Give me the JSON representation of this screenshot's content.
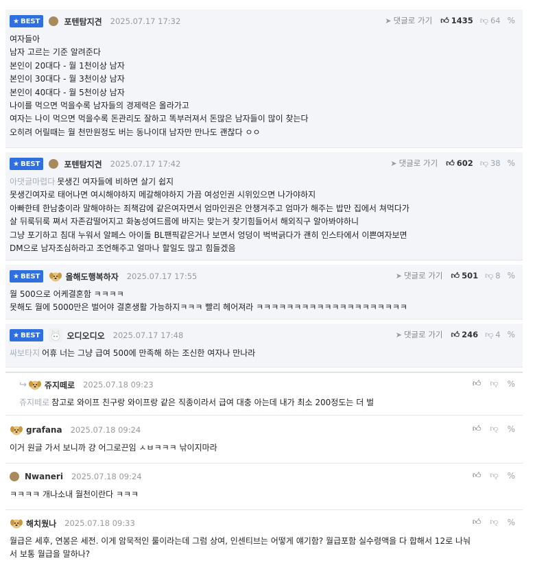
{
  "labels": {
    "best": "BEST",
    "goto": "댓글로 가기"
  },
  "comments": [
    {
      "author": "포텐탐지견",
      "date": "2025.07.17 17:32",
      "likes": "1435",
      "dislikes": "64",
      "lines": [
        "여자들아",
        "남자 고르는 기준 알려준다",
        "본인이 20대다 - 월 1천이상 남자",
        "본인이 30대다 - 월 3천이상 남자",
        "본인이 40대다 - 월 5천이상 남자",
        "나이를 먹으면 먹을수록 남자들의 경제력은 올라가고",
        "여자는 나이 먹으면 먹을수록 돈관리도 잘하고 똑부러져서 돈많은 남자들이 많이 찾는다",
        "오히려 어릴때는 월 천만원정도 버는 동나이대 남자만 만나도 괜찮다 ㅇㅇ"
      ]
    },
    {
      "author": "포텐탐지견",
      "date": "2025.07.17 17:42",
      "likes": "602",
      "dislikes": "38",
      "mention": "아댓글마렵다",
      "lines": [
        "못생긴 여자들에 비하면 살기 쉽지",
        "못생긴여자로 태어나면 여시해야하지 메갈해야하지 가끔 여성인권 시위있으면 나가야하지",
        "아빠한테 한남충이라 말해야하는 죄책감에 같은여자면서 엄마인권은 안챙겨주고 엄마가 해주는 밥만 집에서 쳐먹다가",
        "살 뒤룩뒤룩 쪄서 자존감떨어지고 화농성여드름에 바지는 맞는거 찾기힘들어서 해외직구 알아봐야하니",
        "그냥 포기하고 침대 누워서 알페스 아이돌 BL팬픽같은거나 보면서 엉덩이 벅벅긁다가 괜히 인스타에서 이쁜여자보면",
        "DM으로 남자조심하라고 조언해주고 얼마나 할일도 많고 힘들겠음"
      ]
    },
    {
      "author": "올해도행복하자",
      "date": "2025.07.17 17:55",
      "likes": "501",
      "dislikes": "8",
      "lines": [
        "월 500으로 어케결혼함 ㅋㅋㅋㅋ",
        "못해도 월에 5000만은 벌어야 결혼생활 가능하지ㅋㅋㅋ 빨리 헤어져라 ㅋㅋㅋㅋㅋㅋㅋㅋㅋㅋㅋㅋㅋㅋㅋㅋㅋㅋㅋㅋ"
      ]
    },
    {
      "author": "오디오디오",
      "date": "2025.07.17 17:48",
      "likes": "246",
      "dislikes": "4",
      "mention": "싸보타지",
      "lines": [
        "어휴 너는 그냥 급여 500에 만족해 하는 조신한 여자나 만나라"
      ]
    },
    {
      "author": "쥬지떼로",
      "date": "2025.07.18 09:23",
      "mention": "쥬지떼로",
      "lines": [
        "참고로 와이프 친구랑 와이프랑 같은 직종이라서 급여 대충 아는데 내가 최소 200정도는 더 벌"
      ]
    },
    {
      "author": "grafana",
      "date": "2025.07.18 09:24",
      "lines": [
        "이거 원글 가서 보니까 걍 어그로끈임 ㅅㅂㅋㅋㅋ 낚이지마라"
      ]
    },
    {
      "author": "Nwaneri",
      "date": "2025.07.18 09:24",
      "lines": [
        "ㅋㅋㅋㅋ 개나소내 월천이란다 ㅋㅋㅋ"
      ]
    },
    {
      "author": "해치웠나",
      "date": "2025.07.18 09:33",
      "lines": [
        "월급은 세후, 연봉은 세전. 이게 암묵적인 룰이라는데 그럼 상여, 인센티브는 어떻게 얘기함? 월급포함 실수령액을 다 합해서 12로 나눠",
        "서 보통 월급을 말하나?"
      ]
    }
  ]
}
